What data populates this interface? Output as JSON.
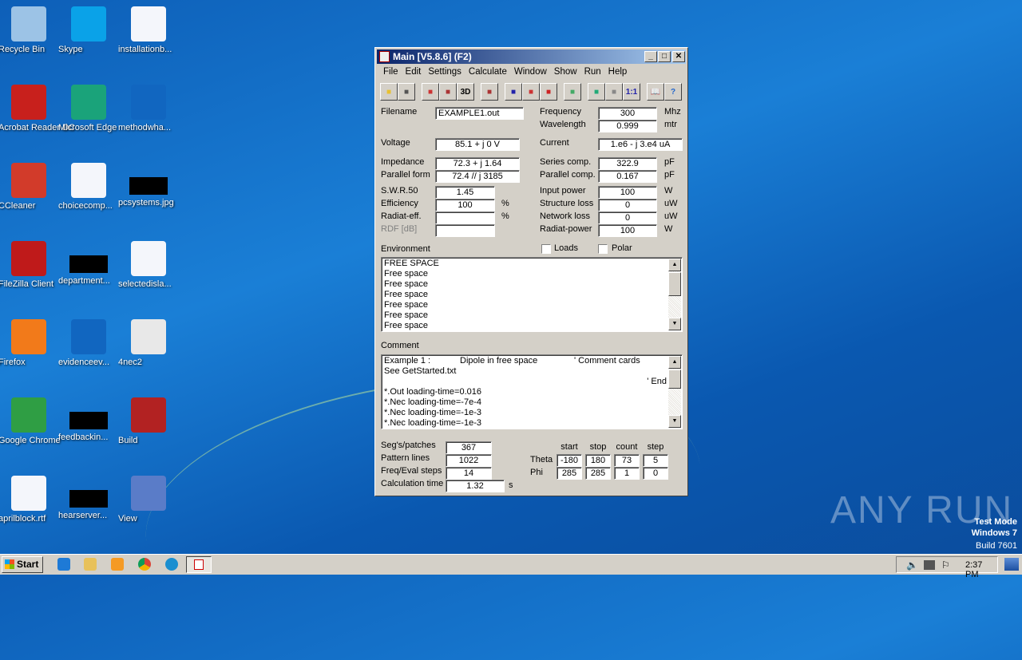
{
  "desktop": {
    "icons": [
      {
        "label": "Recycle Bin",
        "icon": "recycle-bin-icon",
        "color": "#9cc3e6"
      },
      {
        "label": "Skype",
        "icon": "skype-icon",
        "color": "#0aa2e8"
      },
      {
        "label": "installationb...",
        "icon": "word-doc-icon",
        "color": "#f4f6fb"
      },
      {
        "label": "Acrobat Reader DC",
        "icon": "acrobat-icon",
        "color": "#c8201c"
      },
      {
        "label": "Microsoft Edge",
        "icon": "edge-icon",
        "color": "#1aa37a"
      },
      {
        "label": "methodwha...",
        "icon": "blank-file-icon",
        "color": "#1166c0"
      },
      {
        "label": "CCleaner",
        "icon": "ccleaner-icon",
        "color": "#d23b2a"
      },
      {
        "label": "choicecomp...",
        "icon": "word-doc-icon",
        "color": "#f4f6fb"
      },
      {
        "label": "pcsystems.jpg",
        "icon": "image-file-icon",
        "color": "#000000"
      },
      {
        "label": "FileZilla Client",
        "icon": "filezilla-icon",
        "color": "#bf1a1a"
      },
      {
        "label": "department...",
        "icon": "black-file-icon",
        "color": "#000000"
      },
      {
        "label": "selectedisla...",
        "icon": "word-doc-icon",
        "color": "#f4f6fb"
      },
      {
        "label": "Firefox",
        "icon": "firefox-icon",
        "color": "#f27a1a"
      },
      {
        "label": "evidenceev...",
        "icon": "blank-file-icon",
        "color": "#1166c0"
      },
      {
        "label": "4nec2",
        "icon": "antenna-icon",
        "color": "#e8e8e8"
      },
      {
        "label": "Google Chrome",
        "icon": "chrome-icon",
        "color": "#2f9e44"
      },
      {
        "label": "feedbackin...",
        "icon": "black-file-icon",
        "color": "#000000"
      },
      {
        "label": "Build",
        "icon": "build-tools-icon",
        "color": "#b22222"
      },
      {
        "label": "aprilblock.rtf",
        "icon": "word-doc-icon",
        "color": "#f4f6fb"
      },
      {
        "label": "hearserver...",
        "icon": "black-file-icon",
        "color": "#000000"
      },
      {
        "label": "View",
        "icon": "view-magnifier-icon",
        "color": "#5a7cc8"
      }
    ]
  },
  "window": {
    "title": "Main [V5.8.6]  (F2)",
    "menu": [
      "File",
      "Edit",
      "Settings",
      "Calculate",
      "Window",
      "Show",
      "Run",
      "Help"
    ],
    "toolbar": [
      "open",
      "save",
      "antenna",
      "box",
      "3D",
      "edit",
      "pattern",
      "chart",
      "smith",
      "optimizer",
      "calculator",
      "nav",
      "1:1",
      "book",
      "help"
    ],
    "labels": {
      "filename": "Filename",
      "frequency": "Frequency",
      "wavelength": "Wavelength",
      "voltage": "Voltage",
      "current": "Current",
      "impedance": "Impedance",
      "parallel_form": "Parallel form",
      "series_comp": "Series comp.",
      "parallel_comp": "Parallel comp.",
      "swr": "S.W.R.50",
      "efficiency": "Efficiency",
      "radiat_eff": "Radiat-eff.",
      "rdf": "RDF [dB]",
      "input_power": "Input power",
      "structure_loss": "Structure loss",
      "network_loss": "Network loss",
      "radiat_power": "Radiat-power",
      "environment": "Environment",
      "loads": "Loads",
      "polar": "Polar",
      "comment": "Comment",
      "segs": "Seg's/patches",
      "pattern_lines": "Pattern lines",
      "freq_steps": "Freq/Eval steps",
      "calc_time": "Calculation time",
      "start": "start",
      "stop": "stop",
      "count": "count",
      "step": "step",
      "theta": "Theta",
      "phi": "Phi"
    },
    "units": {
      "mhz": "Mhz",
      "mtr": "mtr",
      "pf1": "pF",
      "pf2": "pF",
      "pct1": "%",
      "pct2": "%",
      "w1": "W",
      "uw1": "uW",
      "uw2": "uW",
      "w2": "W",
      "s": "s"
    },
    "values": {
      "filename": "EXAMPLE1.out",
      "frequency": "300",
      "wavelength": "0.999",
      "voltage": "85.1 + j 0 V",
      "current": "1.e6 - j 3.e4 uA",
      "impedance": "72.3 + j 1.64",
      "parallel_form": "72.4 // j 3185",
      "series_comp": "322.9",
      "parallel_comp": "0.167",
      "swr": "1.45",
      "efficiency": "100",
      "radiat_eff": "",
      "rdf": "",
      "input_power": "100",
      "structure_loss": "0",
      "network_loss": "0",
      "radiat_power": "100",
      "segs": "367",
      "pattern_lines": "1022",
      "freq_steps": "14",
      "calc_time": "1.32"
    },
    "loads_checked": false,
    "polar_checked": false,
    "environment": [
      "FREE SPACE",
      "Free space",
      "Free space",
      "Free space",
      "Free space",
      "Free space",
      "Free space"
    ],
    "comment": {
      "line1a": "Example 1 :",
      "line1b": "Dipole in free space",
      "line1c": "' Comment cards",
      "line2": "See GetStarted.txt",
      "line3": "' End",
      "lines": [
        "*.Out loading-time=0.016",
        "*.Nec loading-time=-7e-4",
        "*.Nec loading-time=-1e-3",
        "*.Nec loading-time=-1e-3"
      ]
    },
    "theta": [
      "-180",
      "180",
      "73",
      "5"
    ],
    "phi": [
      "285",
      "285",
      "1",
      "0"
    ]
  },
  "taskbar": {
    "start": "Start",
    "clock": "2:37 PM"
  },
  "watermark": {
    "line1": "Test Mode",
    "line2": "Windows 7",
    "line3": "Build 7601",
    "brand": "ANY RUN"
  }
}
